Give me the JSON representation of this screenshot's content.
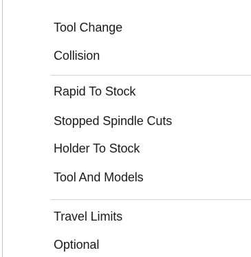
{
  "menu": {
    "groups": [
      {
        "items": [
          {
            "label": "Tool Change"
          },
          {
            "label": "Collision"
          }
        ]
      },
      {
        "items": [
          {
            "label": "Rapid To Stock"
          },
          {
            "label": "Stopped Spindle Cuts"
          },
          {
            "label": "Holder To Stock"
          },
          {
            "label": "Tool And Models"
          }
        ]
      },
      {
        "items": [
          {
            "label": "Travel Limits"
          },
          {
            "label": "Optional"
          }
        ]
      }
    ]
  }
}
